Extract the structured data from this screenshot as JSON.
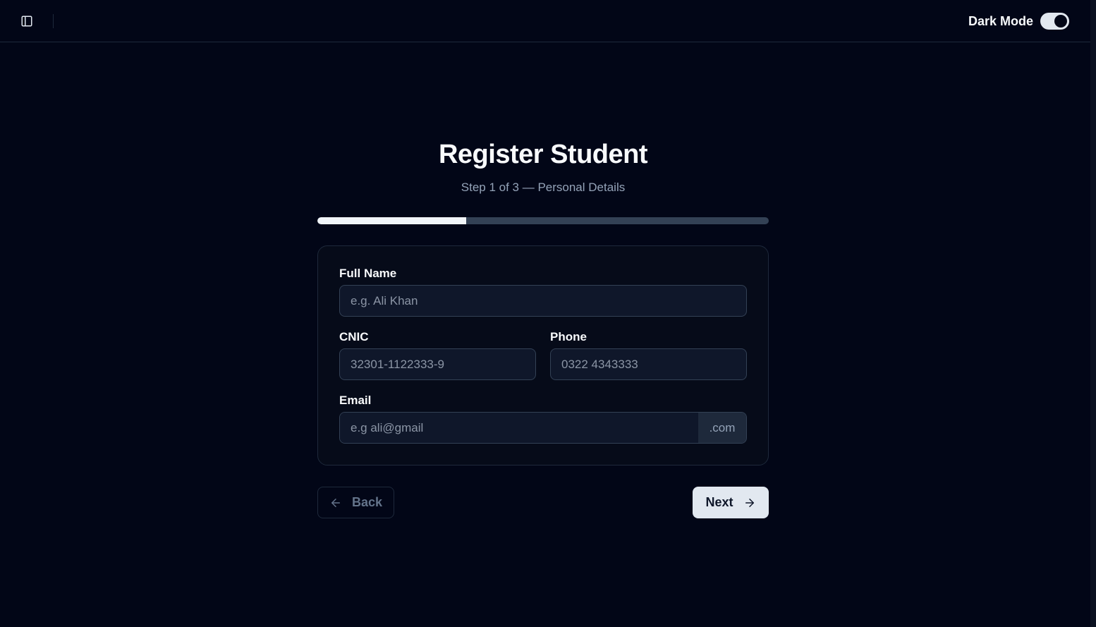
{
  "header": {
    "sidebar_toggle_icon": "panel-left-icon",
    "dark_mode_label": "Dark Mode",
    "dark_mode_on": true
  },
  "form": {
    "title": "Register Student",
    "subtitle": "Step 1 of 3 — Personal Details",
    "progress_fraction": 0.33,
    "fields": {
      "full_name": {
        "label": "Full Name",
        "placeholder": "e.g. Ali Khan",
        "value": ""
      },
      "cnic": {
        "label": "CNIC",
        "placeholder": "32301-1122333-9",
        "value": ""
      },
      "phone": {
        "label": "Phone",
        "placeholder": "0322 4343333",
        "value": ""
      },
      "email": {
        "label": "Email",
        "placeholder": "e.g ali@gmail",
        "value": "",
        "suffix": ".com"
      }
    },
    "buttons": {
      "back_label": "Back",
      "back_icon": "arrow-left-icon",
      "next_label": "Next",
      "next_icon": "arrow-right-icon"
    }
  },
  "colors": {
    "background": "#020617",
    "card": "#060b19",
    "border": "#1e293b",
    "progress_fill": "#f1f5f9",
    "primary_button": "#e2e8f0"
  }
}
